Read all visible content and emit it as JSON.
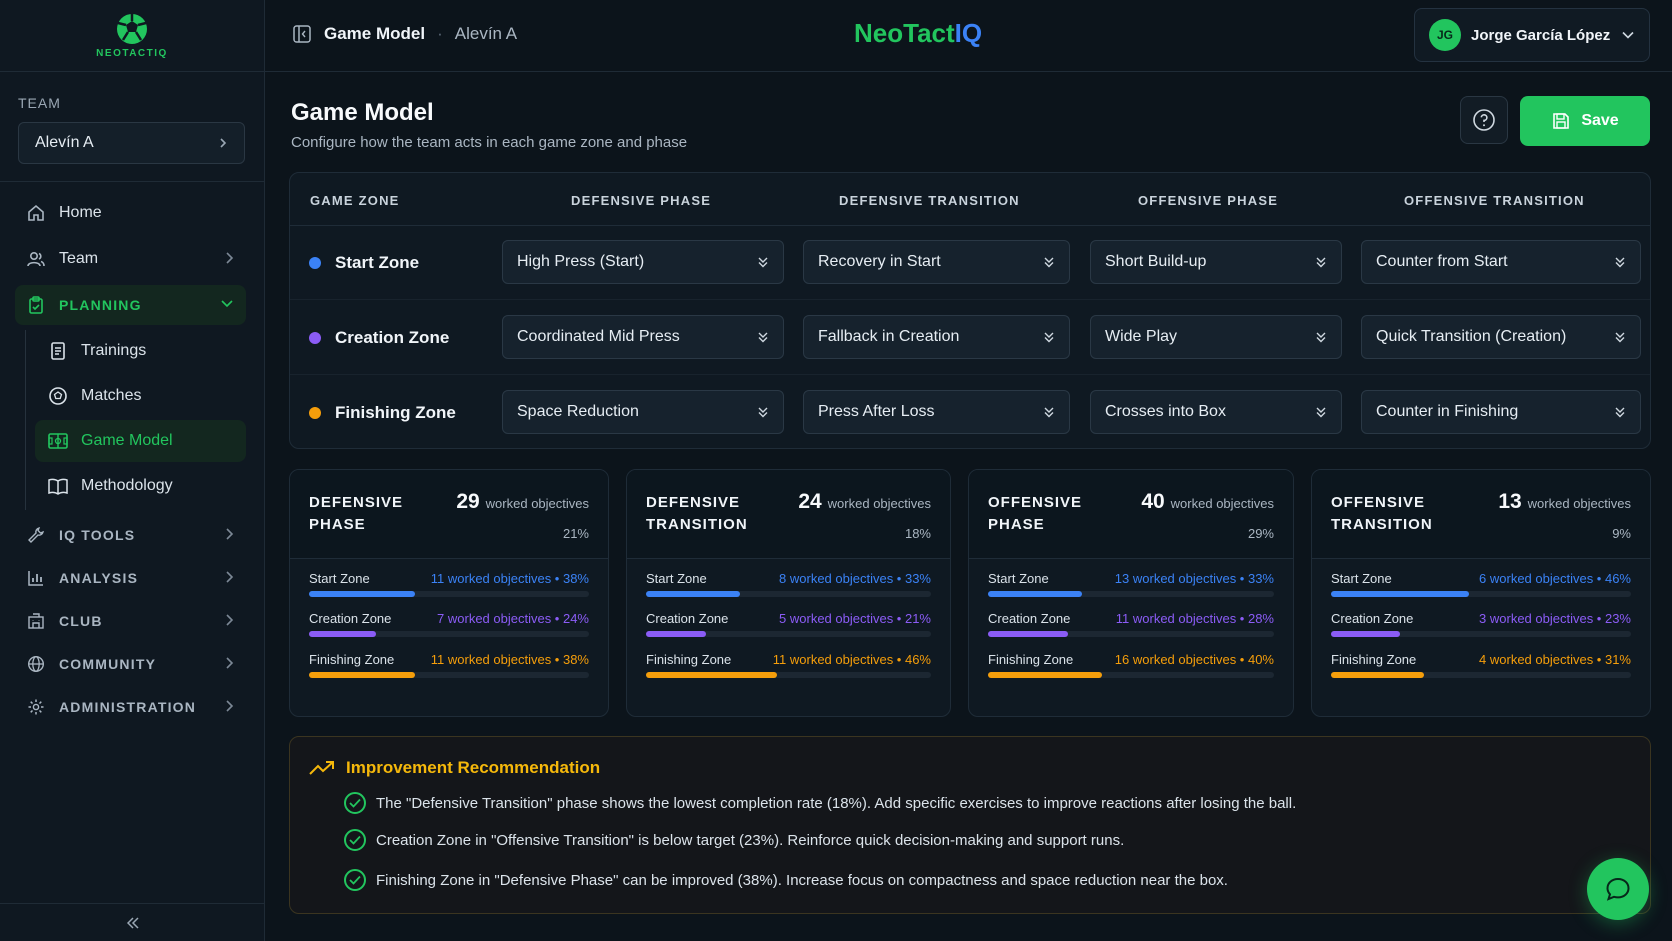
{
  "app": {
    "logo_text": "NEOTACTIQ",
    "brand_part1": "NeoTact",
    "brand_part2": "IQ"
  },
  "sidebar": {
    "team_label": "TEAM",
    "team_value": "Alevín A",
    "home": "Home",
    "team": "Team",
    "planning": "PLANNING",
    "trainings": "Trainings",
    "matches": "Matches",
    "game_model": "Game Model",
    "methodology": "Methodology",
    "iq_tools": "IQ TOOLS",
    "analysis": "ANALYSIS",
    "club": "CLUB",
    "community": "COMMUNITY",
    "administration": "ADMINISTRATION"
  },
  "header": {
    "breadcrumb_main": "Game Model",
    "breadcrumb_sep": "·",
    "breadcrumb_sub": "Alevín A",
    "user_initials": "JG",
    "user_name": "Jorge García López"
  },
  "page": {
    "title": "Game Model",
    "subtitle": "Configure how the team acts in each game zone and phase",
    "save_label": "Save"
  },
  "model": {
    "headers": [
      "GAME ZONE",
      "DEFENSIVE PHASE",
      "DEFENSIVE TRANSITION",
      "OFFENSIVE PHASE",
      "OFFENSIVE TRANSITION"
    ],
    "rows": [
      {
        "zone": "Start Zone",
        "dot_color": "#3b82f6",
        "values": [
          "High Press (Start)",
          "Recovery in Start",
          "Short Build-up",
          "Counter from Start"
        ]
      },
      {
        "zone": "Creation Zone",
        "dot_color": "#8b5cf6",
        "values": [
          "Coordinated Mid Press",
          "Fallback in Creation",
          "Wide Play",
          "Quick Transition (Creation)"
        ]
      },
      {
        "zone": "Finishing Zone",
        "dot_color": "#f59e0b",
        "values": [
          "Space Reduction",
          "Press After Loss",
          "Crosses into Box",
          "Counter in Finishing"
        ]
      }
    ]
  },
  "cards": [
    {
      "title": "DEFENSIVE PHASE",
      "count": "29",
      "count_label": "worked objectives",
      "pct": "21%",
      "zones": [
        {
          "name": "Start Zone",
          "value": "11 worked objectives • 38%",
          "fraction": 0.38,
          "color": "#3b82f6"
        },
        {
          "name": "Creation Zone",
          "value": "7 worked objectives • 24%",
          "fraction": 0.24,
          "color": "#8b5cf6"
        },
        {
          "name": "Finishing Zone",
          "value": "11 worked objectives • 38%",
          "fraction": 0.38,
          "color": "#f59e0b"
        }
      ]
    },
    {
      "title": "DEFENSIVE TRANSITION",
      "count": "24",
      "count_label": "worked objectives",
      "pct": "18%",
      "zones": [
        {
          "name": "Start Zone",
          "value": "8 worked objectives • 33%",
          "fraction": 0.33,
          "color": "#3b82f6"
        },
        {
          "name": "Creation Zone",
          "value": "5 worked objectives • 21%",
          "fraction": 0.21,
          "color": "#8b5cf6"
        },
        {
          "name": "Finishing Zone",
          "value": "11 worked objectives • 46%",
          "fraction": 0.46,
          "color": "#f59e0b"
        }
      ]
    },
    {
      "title": "OFFENSIVE PHASE",
      "count": "40",
      "count_label": "worked objectives",
      "pct": "29%",
      "zones": [
        {
          "name": "Start Zone",
          "value": "13 worked objectives • 33%",
          "fraction": 0.33,
          "color": "#3b82f6"
        },
        {
          "name": "Creation Zone",
          "value": "11 worked objectives • 28%",
          "fraction": 0.28,
          "color": "#8b5cf6"
        },
        {
          "name": "Finishing Zone",
          "value": "16 worked objectives • 40%",
          "fraction": 0.4,
          "color": "#f59e0b"
        }
      ]
    },
    {
      "title": "OFFENSIVE TRANSITION",
      "count": "13",
      "count_label": "worked objectives",
      "pct": "9%",
      "zones": [
        {
          "name": "Start Zone",
          "value": "6 worked objectives • 46%",
          "fraction": 0.46,
          "color": "#3b82f6"
        },
        {
          "name": "Creation Zone",
          "value": "3 worked objectives • 23%",
          "fraction": 0.23,
          "color": "#8b5cf6"
        },
        {
          "name": "Finishing Zone",
          "value": "4 worked objectives • 31%",
          "fraction": 0.31,
          "color": "#f59e0b"
        }
      ]
    }
  ],
  "recommendation": {
    "title": "Improvement Recommendation",
    "items": [
      "The \"Defensive Transition\" phase shows the lowest completion rate (18%). Add specific exercises to improve reactions after losing the ball.",
      "Creation Zone in \"Offensive Transition\" is below target (23%). Reinforce quick decision-making and support runs.",
      "Finishing Zone in \"Defensive Phase\" can be improved (38%). Increase focus on compactness and space reduction near the box."
    ]
  },
  "colors": {
    "accent": "#22c55e",
    "brand_blue": "#3b82f6",
    "warning": "#f5b80b"
  },
  "icons": {
    "logo": "soccer-ball-icon",
    "sidebar_toggle": "sidebar-toggle-icon",
    "help": "help-circle-icon",
    "save": "floppy-disk-icon",
    "chat": "chat-bubble-icon",
    "trend": "trending-up-icon"
  }
}
